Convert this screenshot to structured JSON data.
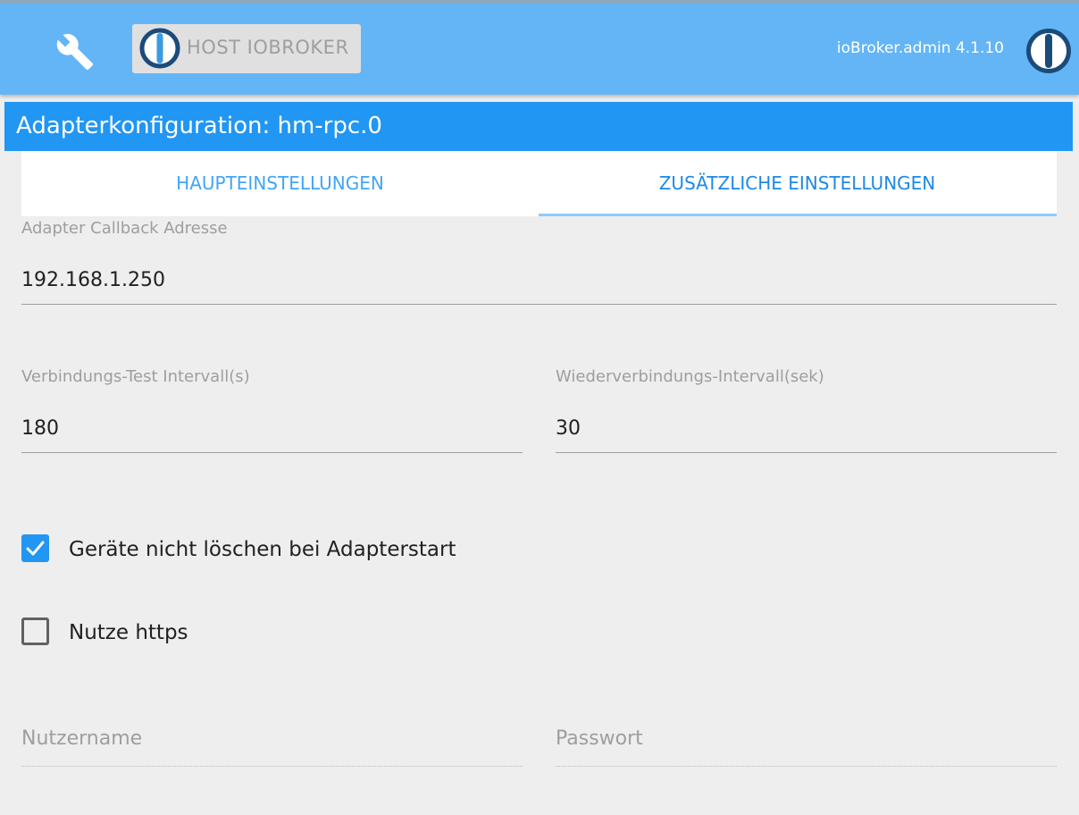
{
  "header": {
    "host_label": "HOST IOBROKER",
    "version": "ioBroker.admin 4.1.10"
  },
  "title": "Adapterkonfiguration: hm-rpc.0",
  "tabs": [
    {
      "label": "HAUPTEINSTELLUNGEN",
      "active": false
    },
    {
      "label": "ZUSÄTZLICHE EINSTELLUNGEN",
      "active": true
    }
  ],
  "fields": {
    "callback": {
      "label": "Adapter Callback Adresse",
      "value": "192.168.1.250"
    },
    "test_interval": {
      "label": "Verbindungs-Test Intervall(s)",
      "value": "180"
    },
    "reconnect_interval": {
      "label": "Wiederverbindungs-Intervall(sek)",
      "value": "30"
    },
    "username": {
      "placeholder": "Nutzername",
      "value": ""
    },
    "password": {
      "placeholder": "Passwort",
      "value": ""
    }
  },
  "checkboxes": {
    "dont_delete": {
      "label": "Geräte nicht löschen bei Adapterstart",
      "checked": true
    },
    "use_https": {
      "label": "Nutze https",
      "checked": false
    }
  },
  "colors": {
    "header_bg": "#64b5f6",
    "title_bg": "#2196f3",
    "accent": "#2196f3",
    "page_bg": "#eeeeee",
    "logo_blue": "#1b4b7a"
  },
  "icons": {
    "settings": "wrench-icon",
    "brand": "iobroker-logo-icon",
    "check": "checkmark-icon"
  }
}
